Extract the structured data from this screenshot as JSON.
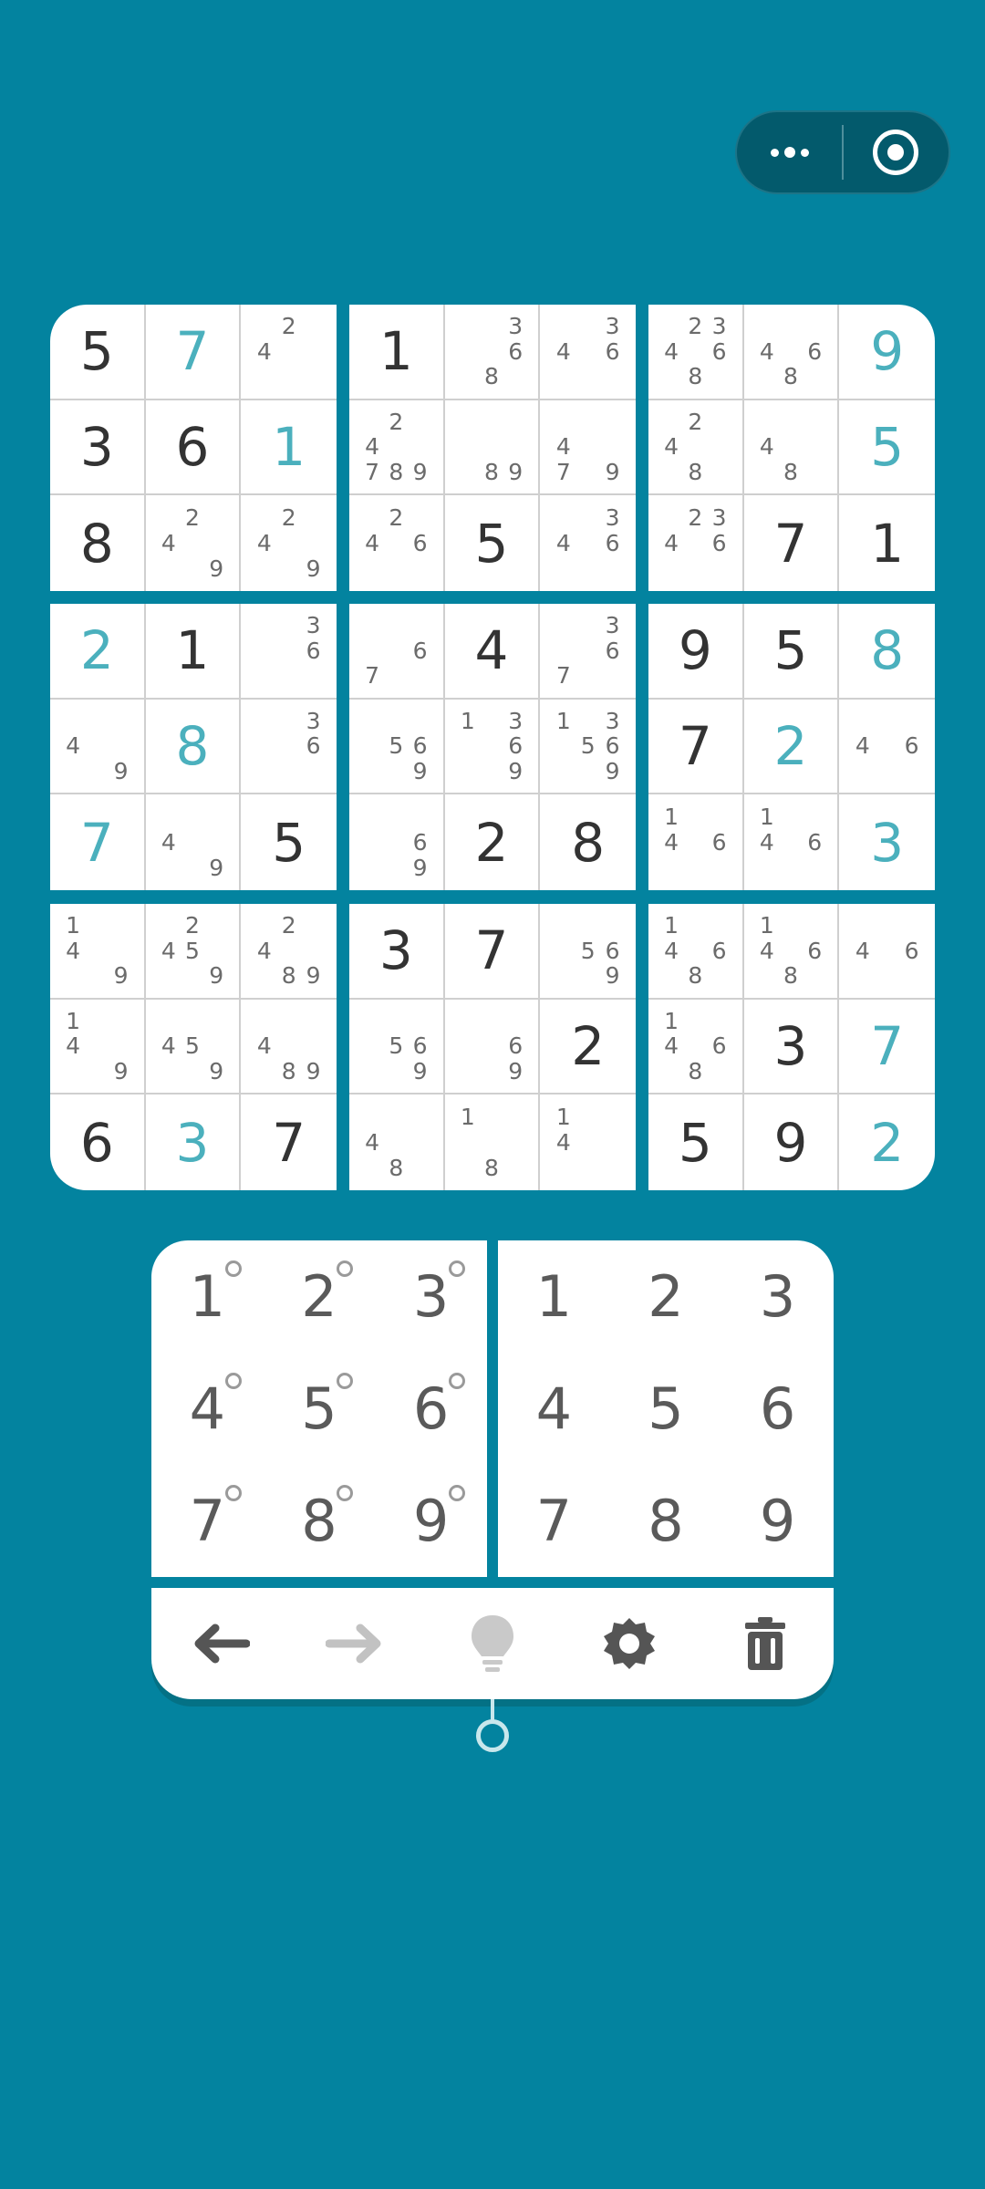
{
  "colors": {
    "background": "#03839f",
    "given_digit": "#333333",
    "user_digit": "#4bb0bd",
    "note": "#6b6b6b"
  },
  "grid": [
    [
      {
        "v": "5",
        "t": "given"
      },
      {
        "v": "7",
        "t": "user"
      },
      {
        "n": "24"
      },
      {
        "v": "1",
        "t": "given"
      },
      {
        "n": "368"
      },
      {
        "n": "346"
      },
      {
        "n": "23468"
      },
      {
        "n": "468"
      },
      {
        "v": "9",
        "t": "user"
      }
    ],
    [
      {
        "v": "3",
        "t": "given"
      },
      {
        "v": "6",
        "t": "given"
      },
      {
        "v": "1",
        "t": "user"
      },
      {
        "n": "24789"
      },
      {
        "n": "89"
      },
      {
        "n": "479"
      },
      {
        "n": "248"
      },
      {
        "n": "48"
      },
      {
        "v": "5",
        "t": "user"
      }
    ],
    [
      {
        "v": "8",
        "t": "given"
      },
      {
        "n": "249"
      },
      {
        "n": "249"
      },
      {
        "n": "246"
      },
      {
        "v": "5",
        "t": "given"
      },
      {
        "n": "346"
      },
      {
        "n": "2346"
      },
      {
        "v": "7",
        "t": "given"
      },
      {
        "v": "1",
        "t": "given"
      }
    ],
    [
      {
        "v": "2",
        "t": "user"
      },
      {
        "v": "1",
        "t": "given"
      },
      {
        "n": "36"
      },
      {
        "n": "67"
      },
      {
        "v": "4",
        "t": "given"
      },
      {
        "n": "367"
      },
      {
        "v": "9",
        "t": "given"
      },
      {
        "v": "5",
        "t": "given"
      },
      {
        "v": "8",
        "t": "user"
      }
    ],
    [
      {
        "n": "49"
      },
      {
        "v": "8",
        "t": "user"
      },
      {
        "n": "36"
      },
      {
        "n": "569"
      },
      {
        "n": "1369"
      },
      {
        "n": "13569"
      },
      {
        "v": "7",
        "t": "given"
      },
      {
        "v": "2",
        "t": "user"
      },
      {
        "n": "46"
      }
    ],
    [
      {
        "v": "7",
        "t": "user"
      },
      {
        "n": "49"
      },
      {
        "v": "5",
        "t": "given"
      },
      {
        "n": "69"
      },
      {
        "v": "2",
        "t": "given"
      },
      {
        "v": "8",
        "t": "given"
      },
      {
        "n": "146"
      },
      {
        "n": "146"
      },
      {
        "v": "3",
        "t": "user"
      }
    ],
    [
      {
        "n": "149"
      },
      {
        "n": "2459"
      },
      {
        "n": "2489"
      },
      {
        "v": "3",
        "t": "given"
      },
      {
        "v": "7",
        "t": "given"
      },
      {
        "n": "569"
      },
      {
        "n": "1468"
      },
      {
        "n": "1468"
      },
      {
        "n": "46"
      }
    ],
    [
      {
        "n": "149"
      },
      {
        "n": "459"
      },
      {
        "n": "489"
      },
      {
        "n": "569"
      },
      {
        "n": "69"
      },
      {
        "v": "2",
        "t": "given"
      },
      {
        "n": "1468"
      },
      {
        "v": "3",
        "t": "given"
      },
      {
        "v": "7",
        "t": "user"
      }
    ],
    [
      {
        "v": "6",
        "t": "given"
      },
      {
        "v": "3",
        "t": "user"
      },
      {
        "v": "7",
        "t": "given"
      },
      {
        "n": "48"
      },
      {
        "n": "18"
      },
      {
        "n": "14"
      },
      {
        "v": "5",
        "t": "given"
      },
      {
        "v": "9",
        "t": "given"
      },
      {
        "v": "2",
        "t": "user"
      }
    ]
  ],
  "note_pad": {
    "keys": [
      "1",
      "2",
      "3",
      "4",
      "5",
      "6",
      "7",
      "8",
      "9"
    ]
  },
  "number_pad": {
    "keys": [
      "1",
      "2",
      "3",
      "4",
      "5",
      "6",
      "7",
      "8",
      "9"
    ]
  },
  "toolbar": {
    "icons": [
      "undo-arrow-icon",
      "redo-arrow-icon",
      "hint-bulb-icon",
      "settings-gear-icon",
      "delete-trash-icon"
    ]
  },
  "capsule": {
    "icons": [
      "more-dots-icon",
      "close-target-icon"
    ]
  }
}
